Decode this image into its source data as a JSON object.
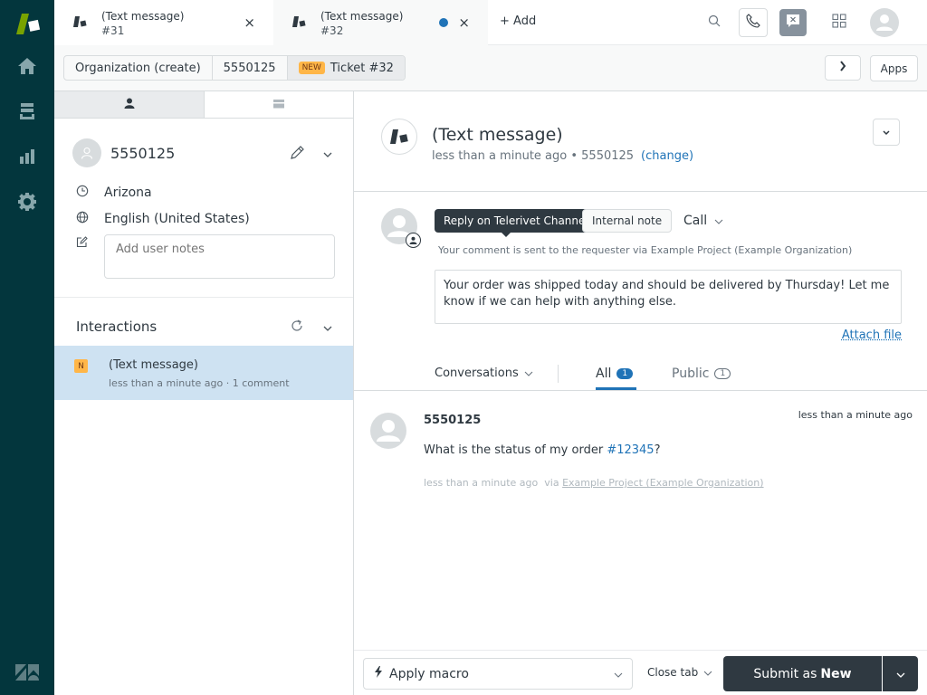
{
  "nav": {
    "items": [
      {
        "id": "home",
        "icon": "home-icon"
      },
      {
        "id": "views",
        "icon": "views-icon"
      },
      {
        "id": "reporting",
        "icon": "reporting-icon"
      },
      {
        "id": "admin",
        "icon": "gear-icon"
      }
    ]
  },
  "tabs": [
    {
      "title": "(Text message)",
      "sub": "#31",
      "close": "×"
    },
    {
      "title": "(Text message)",
      "sub": "#32",
      "close": "×",
      "unsaved": true
    }
  ],
  "toolbar": {
    "add_label": "+ Add",
    "apps_label": "Apps"
  },
  "breadcrumbs": [
    {
      "label": "Organization (create)"
    },
    {
      "label": "5550125"
    },
    {
      "badge": "NEW",
      "label": "Ticket #32"
    }
  ],
  "user": {
    "name": "5550125",
    "timezone": "Arizona",
    "language": "English (United States)",
    "notes_placeholder": "Add user notes"
  },
  "interactions": {
    "title": "Interactions",
    "items": [
      {
        "badge": "N",
        "title": "(Text message)",
        "sub": "less than a minute ago · 1 comment"
      }
    ]
  },
  "ticket": {
    "title": "(Text message)",
    "meta": "less than a minute ago • 5550125",
    "change_label": "(change)"
  },
  "composer": {
    "reply_label": "Reply on Telerivet Channel",
    "note_label": "Internal note",
    "call_label": "Call",
    "hint": "Your comment is sent to the requester via Example Project (Example Organization)",
    "body": "Your order was shipped today and should be delivered by Thursday! Let me know if we can help with anything else.",
    "attach_label": "Attach file"
  },
  "filters": {
    "conversations_label": "Conversations",
    "all_label": "All",
    "all_count": "1",
    "public_label": "Public",
    "public_count": "1"
  },
  "messages": [
    {
      "author": "5550125",
      "time": "less than a minute ago",
      "body_prefix": "What is the status of my order ",
      "order_link": "#12345",
      "body_suffix": "?",
      "meta_time": "less than a minute ago",
      "meta_via": "via",
      "meta_channel": "Example Project (Example Organization)"
    }
  ],
  "footer": {
    "macro_label": "Apply macro",
    "close_tab_label": "Close tab",
    "submit_prefix": "Submit as",
    "submit_status": "New"
  },
  "colors": {
    "nav_bg": "#03363d",
    "accent": "#1f73b7",
    "dark_button": "#2f3941",
    "new_badge": "#ffb648",
    "selected_row": "#cee2f2"
  }
}
